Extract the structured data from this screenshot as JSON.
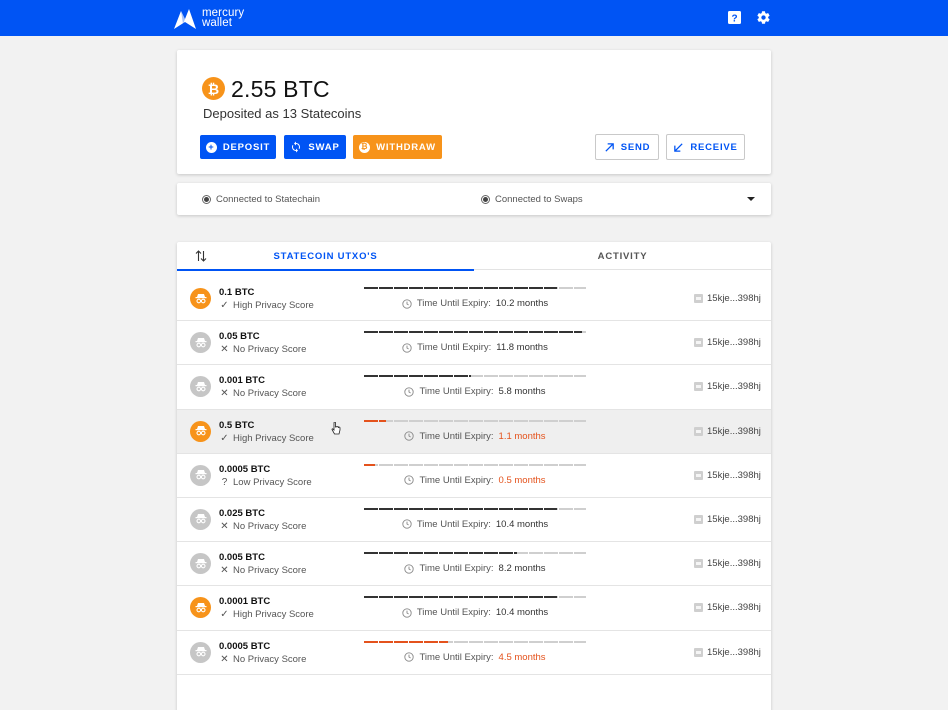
{
  "header": {
    "logo_line1": "mercury",
    "logo_line2": "wallet",
    "icons": [
      "help-icon",
      "settings-icon"
    ],
    "color": "#0054f4"
  },
  "balance": {
    "amount": "2.55 BTC",
    "subtitle": "Deposited as 13 Statecoins",
    "buttons": {
      "deposit": "DEPOSIT",
      "swap": "SWAP",
      "withdraw": "WITHDRAW",
      "send": "SEND",
      "receive": "RECEIVE"
    }
  },
  "status": {
    "statechain": "Connected to Statechain",
    "swaps": "Connected to Swaps"
  },
  "tabs": {
    "utxos": "STATECOIN UTXO'S",
    "activity": "ACTIVITY"
  },
  "coins": [
    {
      "amount": "0.1 BTC",
      "privacy": "High Privacy Score",
      "privacy_icon": "check-icon",
      "badge": "orange",
      "expiry_label": "Time Until Expiry:",
      "expiry": "10.2 months",
      "expiry_fraction": 0.87,
      "warn": false,
      "address": "15kje...398hj"
    },
    {
      "amount": "0.05 BTC",
      "privacy": "No Privacy Score",
      "privacy_icon": "cross-icon",
      "badge": "grey",
      "expiry_label": "Time Until Expiry:",
      "expiry": "11.8 months",
      "expiry_fraction": 0.98,
      "warn": false,
      "address": "15kje...398hj"
    },
    {
      "amount": "0.001 BTC",
      "privacy": "No Privacy Score",
      "privacy_icon": "cross-icon",
      "badge": "grey",
      "expiry_label": "Time Until Expiry:",
      "expiry": "5.8 months",
      "expiry_fraction": 0.48,
      "warn": false,
      "address": "15kje...398hj"
    },
    {
      "amount": "0.5 BTC",
      "privacy": "High Privacy Score",
      "privacy_icon": "check-icon",
      "badge": "orange",
      "expiry_label": "Time Until Expiry:",
      "expiry": "1.1 months",
      "expiry_fraction": 0.1,
      "warn": true,
      "address": "15kje...398hj",
      "highlight": true
    },
    {
      "amount": "0.0005 BTC",
      "privacy": "Low Privacy Score",
      "privacy_icon": "question-icon",
      "badge": "grey",
      "expiry_label": "Time Until Expiry:",
      "expiry": "0.5 months",
      "expiry_fraction": 0.05,
      "warn": true,
      "address": "15kje...398hj"
    },
    {
      "amount": "0.025 BTC",
      "privacy": "No Privacy Score",
      "privacy_icon": "cross-icon",
      "badge": "grey",
      "expiry_label": "Time Until Expiry:",
      "expiry": "10.4 months",
      "expiry_fraction": 0.87,
      "warn": false,
      "address": "15kje...398hj"
    },
    {
      "amount": "0.005 BTC",
      "privacy": "No Privacy Score",
      "privacy_icon": "cross-icon",
      "badge": "grey",
      "expiry_label": "Time Until Expiry:",
      "expiry": "8.2 months",
      "expiry_fraction": 0.69,
      "warn": false,
      "address": "15kje...398hj"
    },
    {
      "amount": "0.0001 BTC",
      "privacy": "High Privacy Score",
      "privacy_icon": "check-icon",
      "badge": "orange",
      "expiry_label": "Time Until Expiry:",
      "expiry": "10.4 months",
      "expiry_fraction": 0.87,
      "warn": false,
      "address": "15kje...398hj"
    },
    {
      "amount": "0.0005 BTC",
      "privacy": "No Privacy Score",
      "privacy_icon": "cross-icon",
      "badge": "grey",
      "expiry_label": "Time Until Expiry:",
      "expiry": "4.5 months",
      "expiry_fraction": 0.38,
      "warn": true,
      "address": "15kje...398hj"
    }
  ],
  "colors": {
    "accent": "#0054f4",
    "btc": "#f7931a",
    "warning": "#e4521c"
  }
}
